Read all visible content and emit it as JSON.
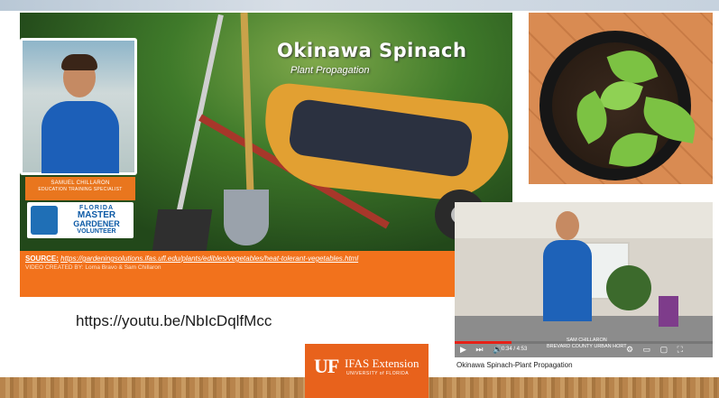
{
  "main_video": {
    "title": "Okinawa Spinach",
    "subtitle": "Plant Propagation",
    "presenter": {
      "name": "SAMUEL CHILLARON",
      "role": "EDUCATION TRAINING SPECIALIST"
    },
    "logo": {
      "line1": "FLORIDA",
      "line2": "MASTER",
      "line3": "GARDENER",
      "line4": "VOLUNTEER"
    },
    "source": {
      "label": "SOURCE:",
      "link": "https://gardeningsolutions.ifas.ufl.edu/plants/edibles/vegetables/heat-tolerant-vegetables.html"
    },
    "credit": "VIDEO CREATED BY: Lorna Bravo & Sam Chillaron"
  },
  "youtube_url": "https://youtu.be/NbIcDqlfMcc",
  "youtube_embed": {
    "title": "Okinawa Spinach-Plant Propagation",
    "caption_line1": "SAM CHILLARON",
    "caption_line2": "BREVARD COUNTY URBAN HORT",
    "time": "0:34 / 4:53",
    "progress": 0.22,
    "controls_left": "▶ ⏭ 🔊",
    "controls_right": "⚙ ▭ ▢ ⛶"
  },
  "uf_logo": {
    "mark": "UF",
    "name": "IFAS Extension",
    "university": "UNIVERSITY of FLORIDA"
  },
  "colors": {
    "accent_orange": "#f2721c",
    "uf_orange": "#e8621c",
    "shirt_blue": "#1e62b8",
    "youtube_red": "#e62117"
  }
}
